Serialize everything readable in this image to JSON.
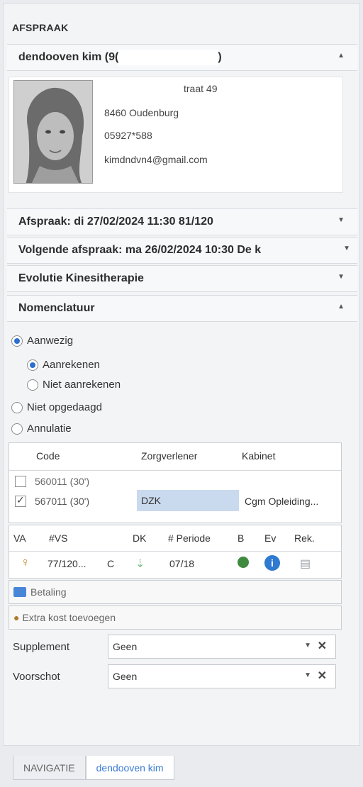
{
  "panel": {
    "title": "AFSPRAAK"
  },
  "patient_header": {
    "name": "dendooven kim (9(",
    "name_tail": ")",
    "expanded": true
  },
  "contact": {
    "street_tail": "traat 49",
    "city": "8460 Oudenburg",
    "phone": "05927*588",
    "email": "kimdndvn4@gmail.com"
  },
  "sections": {
    "afspraak": "Afspraak: di 27/02/2024 11:30 81/120",
    "volgende": "Volgende afspraak: ma 26/02/2024 10:30 De k",
    "evolutie": "Evolutie Kinesitherapie",
    "nomenclatuur": "Nomenclatuur"
  },
  "presence": {
    "aanwezig": "Aanwezig",
    "aanrekenen": "Aanrekenen",
    "niet_aanrekenen": "Niet aanrekenen",
    "niet_opgedaagd": "Niet opgedaagd",
    "annulatie": "Annulatie",
    "selected": "aanwezig",
    "sub_selected": "aanrekenen"
  },
  "nomen_grid": {
    "columns": [
      "Code",
      "Zorgverlener",
      "Kabinet"
    ],
    "rows": [
      {
        "checked": false,
        "code": "560011 (30')",
        "provider": "",
        "kabinet": ""
      },
      {
        "checked": true,
        "code": "567011 (30')",
        "provider": "DZK",
        "kabinet": "Cgm Opleiding..."
      }
    ]
  },
  "session_grid": {
    "columns": [
      "VA",
      "#VS",
      "DK",
      "# Periode",
      "B",
      "Ev",
      "Rek."
    ],
    "row": {
      "vs": "77/120...",
      "dk": "C",
      "periode": "07/18"
    }
  },
  "betaling": "Betaling",
  "extra_kost": "Extra kost toevoegen",
  "supplement": {
    "label": "Supplement",
    "value": "Geen"
  },
  "voorschot": {
    "label": "Voorschot",
    "value": "Geen"
  },
  "tabs": [
    {
      "label": "NAVIGATIE",
      "active": false
    },
    {
      "label": "dendooven kim",
      "active": true
    }
  ]
}
